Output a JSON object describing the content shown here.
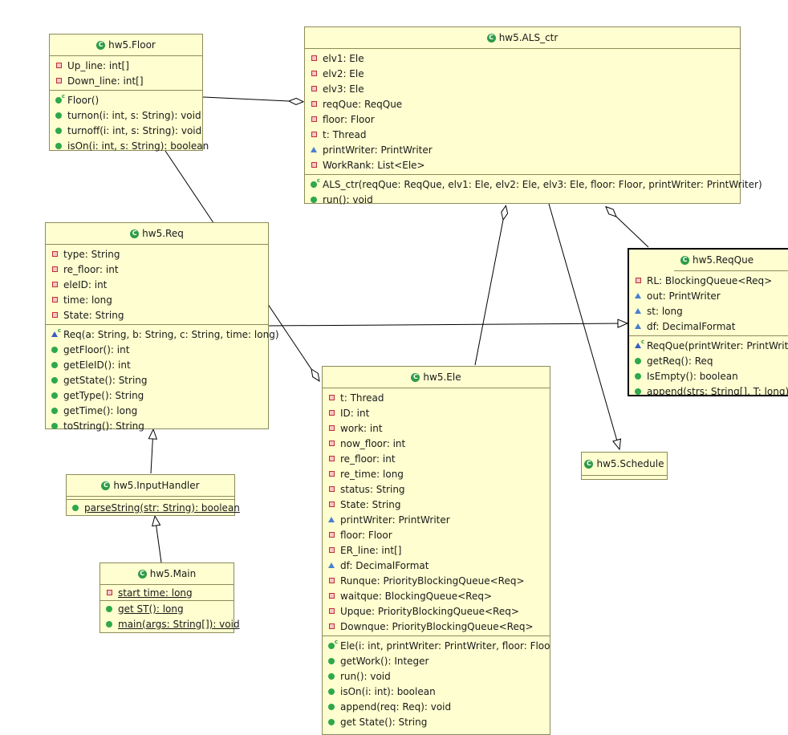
{
  "classes": {
    "floor": {
      "title": "hw5.Floor",
      "attrs": [
        "Up_line: int[]",
        "Down_line: int[]"
      ],
      "ops": [
        "Floor()",
        "turnon(i: int, s: String): void",
        "turnoff(i: int, s: String): void",
        "isOn(i: int, s: String): boolean"
      ]
    },
    "als": {
      "title": "hw5.ALS_ctr",
      "attrs": [
        "elv1: Ele",
        "elv2: Ele",
        "elv3: Ele",
        "reqQue: ReqQue",
        "floor: Floor",
        "t: Thread",
        "printWriter: PrintWriter",
        "WorkRank: List<Ele>"
      ],
      "ops": [
        "ALS_ctr(reqQue: ReqQue, elv1: Ele, elv2: Ele, elv3: Ele, floor: Floor, printWriter: PrintWriter)",
        "run(): void"
      ]
    },
    "req": {
      "title": "hw5.Req",
      "attrs": [
        "type: String",
        "re_floor: int",
        "eleID: int",
        "time: long",
        "State: String"
      ],
      "ops": [
        "Req(a: String, b: String, c: String, time: long)",
        "getFloor(): int",
        "getEleID(): int",
        "getState(): String",
        "getType(): String",
        "getTime(): long",
        "toString(): String"
      ]
    },
    "reqque": {
      "title": "hw5.ReqQue",
      "attrs": [
        "RL: BlockingQueue<Req>",
        "out: PrintWriter",
        "st: long",
        "df: DecimalFormat"
      ],
      "ops": [
        "ReqQue(printWriter: PrintWriter)",
        "getReq(): Req",
        "IsEmpty(): boolean",
        "append(strs: String[], T: long): void"
      ]
    },
    "input": {
      "title": "hw5.InputHandler",
      "ops": [
        "parseString(str: String): boolean"
      ]
    },
    "main": {
      "title": "hw5.Main",
      "attrs": [
        "start time: long"
      ],
      "ops": [
        "get ST(): long",
        "main(args: String[]): void"
      ]
    },
    "ele": {
      "title": "hw5.Ele",
      "attrs": [
        "t: Thread",
        "ID: int",
        "work: int",
        "now_floor: int",
        "re_floor: int",
        "re_time: long",
        "status: String",
        "State: String",
        "printWriter: PrintWriter",
        "floor: Floor",
        "ER_line: int[]",
        "df: DecimalFormat",
        "Runque: PriorityBlockingQueue<Req>",
        "waitque: BlockingQueue<Req>",
        "Upque: PriorityBlockingQueue<Req>",
        "Downque: PriorityBlockingQueue<Req>"
      ],
      "ops": [
        "Ele(i: int, printWriter: PrintWriter, floor: Floor)",
        "getWork(): Integer",
        "run(): void",
        "isOn(i: int): boolean",
        "append(req: Req): void",
        "get State(): String"
      ]
    },
    "schedule": {
      "title": "hw5.Schedule"
    }
  },
  "icons": {
    "class": "class-icon",
    "private_field": "private-field-icon",
    "package_field": "package-field-icon",
    "public_method": "public-method-icon"
  },
  "colors": {
    "class_fill": "#fefed0",
    "class_border": "#8c8c5a",
    "public": "#2ea84a",
    "private": "#c03030",
    "package": "#3b5cc4"
  }
}
